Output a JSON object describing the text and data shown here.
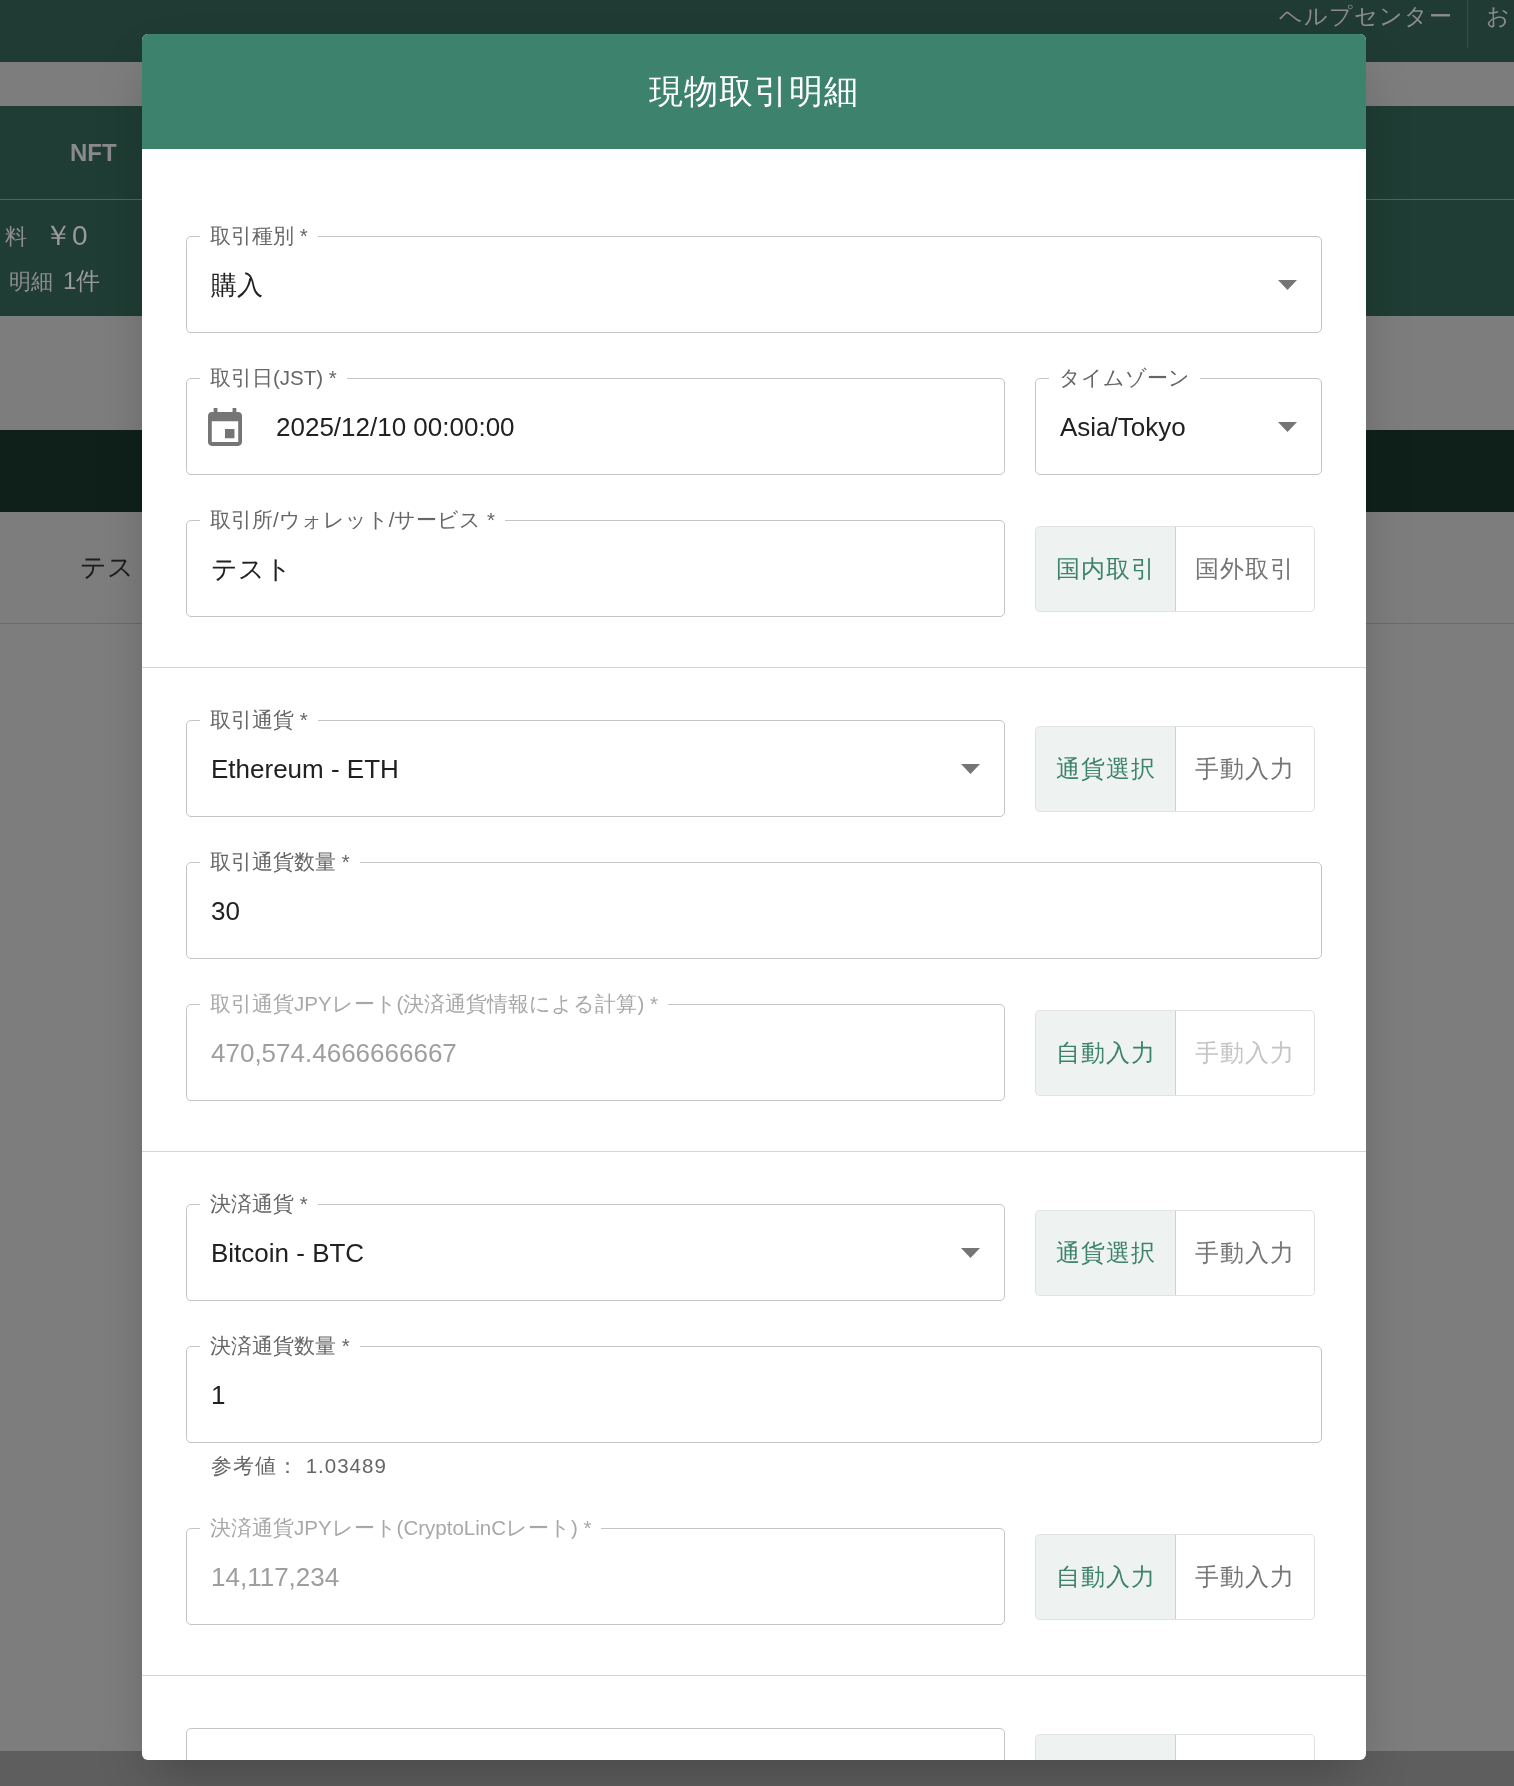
{
  "background_page": {
    "header_links": [
      "ヘルプセンター",
      "お"
    ],
    "nav_tab": "NFT",
    "summary": [
      {
        "label": "料",
        "value": "￥0"
      },
      {
        "label": "明細",
        "value": "1件"
      }
    ],
    "row_text": "テス"
  },
  "dialog": {
    "title": "現物取引明細",
    "sections": [
      {
        "rows": [
          {
            "fields": [
              {
                "kind": "select",
                "label": "取引種別 *",
                "value": "購入",
                "disabled": false
              }
            ]
          },
          {
            "fields": [
              {
                "kind": "date",
                "label": "取引日(JST) *",
                "value": "2025/12/10 00:00:00",
                "disabled": false
              },
              {
                "kind": "select",
                "label": "タイムゾーン",
                "value": "Asia/Tokyo",
                "disabled": false
              }
            ]
          },
          {
            "fields": [
              {
                "kind": "text",
                "label": "取引所/ウォレット/サービス *",
                "value": "テスト",
                "disabled": false
              }
            ],
            "toggle": [
              {
                "label": "国内取引",
                "selected": true,
                "disabled": false
              },
              {
                "label": "国外取引",
                "selected": false,
                "disabled": false
              }
            ]
          }
        ]
      },
      {
        "rows": [
          {
            "fields": [
              {
                "kind": "select",
                "label": "取引通貨 *",
                "value": "Ethereum - ETH",
                "disabled": false
              }
            ],
            "toggle": [
              {
                "label": "通貨選択",
                "selected": true,
                "disabled": false
              },
              {
                "label": "手動入力",
                "selected": false,
                "disabled": false
              }
            ]
          },
          {
            "fields": [
              {
                "kind": "text",
                "label": "取引通貨数量 *",
                "value": "30",
                "disabled": false
              }
            ]
          },
          {
            "fields": [
              {
                "kind": "text",
                "label": "取引通貨JPYレート(決済通貨情報による計算) *",
                "value": "470,574.4666666667",
                "disabled": true
              }
            ],
            "toggle": [
              {
                "label": "自動入力",
                "selected": true,
                "disabled": false
              },
              {
                "label": "手動入力",
                "selected": false,
                "disabled": true
              }
            ]
          }
        ]
      },
      {
        "rows": [
          {
            "fields": [
              {
                "kind": "select",
                "label": "決済通貨 *",
                "value": "Bitcoin - BTC",
                "disabled": false
              }
            ],
            "toggle": [
              {
                "label": "通貨選択",
                "selected": true,
                "disabled": false
              },
              {
                "label": "手動入力",
                "selected": false,
                "disabled": false
              }
            ]
          },
          {
            "fields": [
              {
                "kind": "text",
                "label": "決済通貨数量 *",
                "value": "1",
                "disabled": false,
                "helper": "参考値： 1.03489"
              }
            ]
          },
          {
            "fields": [
              {
                "kind": "text",
                "label": "決済通貨JPYレート(CryptoLinCレート) *",
                "value": "14,117,234",
                "disabled": true
              }
            ],
            "toggle": [
              {
                "label": "自動入力",
                "selected": true,
                "disabled": false
              },
              {
                "label": "手動入力",
                "selected": false,
                "disabled": false
              }
            ]
          }
        ]
      },
      {
        "rows": [
          {
            "fields": [
              {
                "kind": "text"
              }
            ],
            "toggle": [
              {
                "selected": true
              },
              {
                "selected": false
              }
            ]
          }
        ]
      }
    ]
  }
}
